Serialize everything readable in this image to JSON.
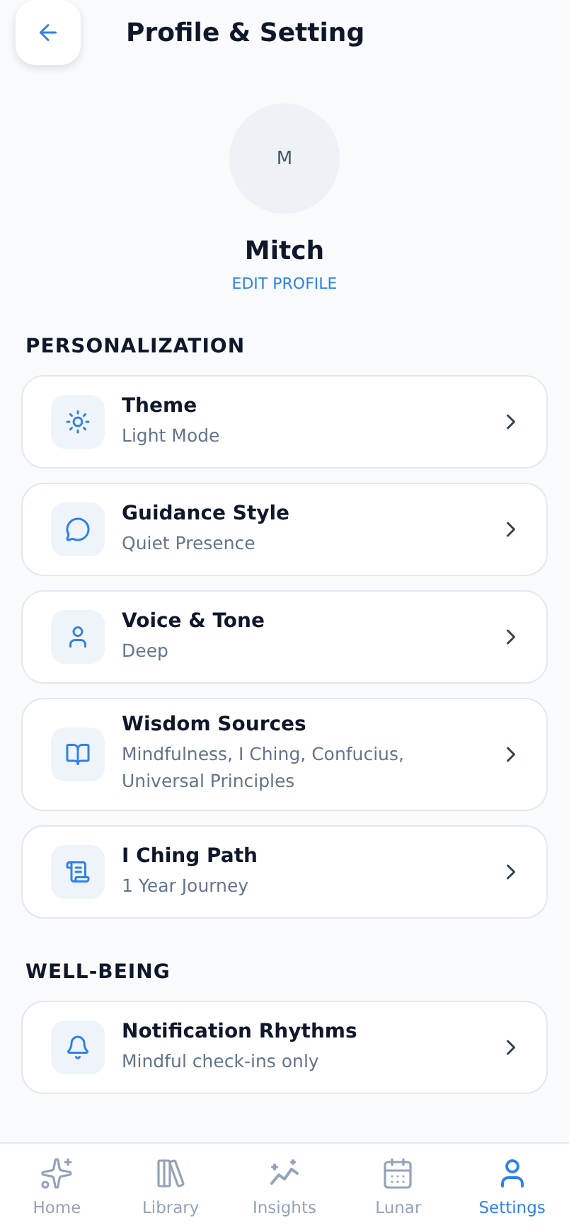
{
  "header": {
    "title": "Profile & Setting"
  },
  "profile": {
    "initial": "M",
    "name": "Mitch",
    "edit_link": "EDIT PROFILE"
  },
  "sections": [
    {
      "title": "PERSONALIZATION",
      "items": [
        {
          "title": "Theme",
          "value": "Light Mode"
        },
        {
          "title": "Guidance Style",
          "value": "Quiet Presence"
        },
        {
          "title": "Voice & Tone",
          "value": "Deep"
        },
        {
          "title": "Wisdom Sources",
          "value": "Mindfulness, I Ching, Confucius, Universal Principles"
        },
        {
          "title": "I Ching Path",
          "value": "1 Year Journey"
        }
      ]
    },
    {
      "title": "WELL-BEING",
      "items": [
        {
          "title": "Notification Rhythms",
          "value": "Mindful check-ins only"
        }
      ]
    }
  ],
  "nav": [
    {
      "label": "Home",
      "selected": false
    },
    {
      "label": "Library",
      "selected": false
    },
    {
      "label": "Insights",
      "selected": false
    },
    {
      "label": "Lunar",
      "selected": false
    },
    {
      "label": "Settings",
      "selected": true
    }
  ]
}
